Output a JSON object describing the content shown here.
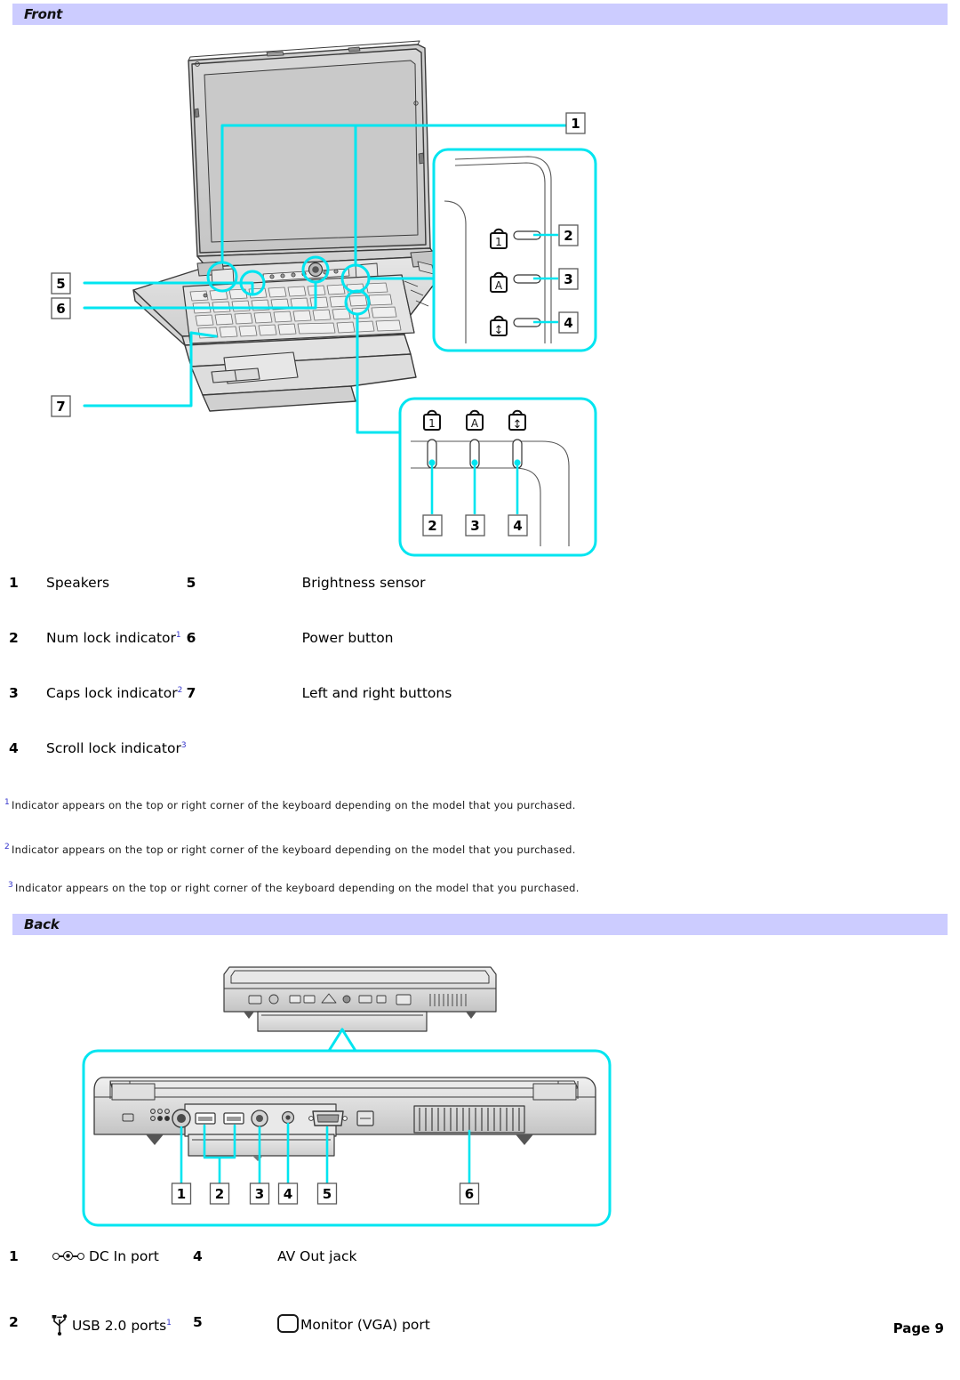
{
  "document": {
    "page_label": "Page 9",
    "accent_color": "#00e5f0",
    "header_bg": "#ccccff"
  },
  "sections": {
    "front": {
      "title": "Front",
      "legend": [
        {
          "num": "1",
          "label": "Speakers",
          "num2": "5",
          "label2": "Brightness sensor"
        },
        {
          "num": "2",
          "label": "Num lock indicator",
          "fn": "1",
          "num2": "6",
          "label2": "Power button"
        },
        {
          "num": "3",
          "label": "Caps lock indicator",
          "fn": "2",
          "num2": "7",
          "label2": "Left and right buttons"
        },
        {
          "num": "4",
          "label": "Scroll lock indicator",
          "fn": "3",
          "num2": "",
          "label2": ""
        }
      ],
      "footnotes": [
        {
          "mark": "1",
          "text": "Indicator appears on the top or right corner of the keyboard depending on the model that you purchased."
        },
        {
          "mark": "2",
          "text": "Indicator appears on the top or right corner of the keyboard depending on the model that you purchased."
        },
        {
          "mark": "3",
          "text": "Indicator appears on the top or right corner of the keyboard depending on the model that you purchased."
        }
      ],
      "callouts": [
        "1",
        "2",
        "3",
        "4",
        "5",
        "6",
        "7"
      ],
      "indicator_icons": [
        "num-lock-padlock-icon",
        "caps-lock-padlock-icon",
        "scroll-lock-padlock-icon"
      ],
      "indicator_glyphs": [
        "1",
        "A",
        "↕"
      ]
    },
    "back": {
      "title": "Back",
      "legend": [
        {
          "num": "1",
          "icon": "dc-in-port-icon",
          "label": "DC In port",
          "num2": "4",
          "icon2": "",
          "label2": "AV Out jack"
        },
        {
          "num": "2",
          "icon": "usb-port-icon",
          "label": "USB 2.0 ports",
          "fn": "1",
          "num2": "5",
          "icon2": "monitor-vga-port-icon",
          "label2": "Monitor (VGA) port"
        }
      ],
      "callouts": [
        "1",
        "2",
        "3",
        "4",
        "5",
        "6"
      ]
    }
  }
}
